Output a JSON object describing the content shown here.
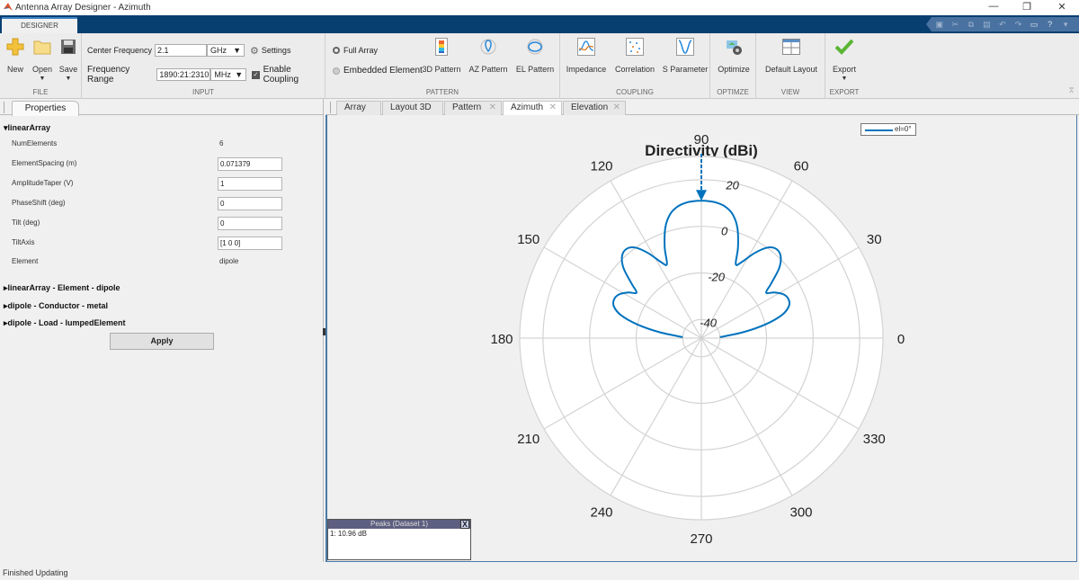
{
  "window": {
    "title": "Antenna Array Designer - Azimuth",
    "controls": [
      "—",
      "❐",
      "✕"
    ]
  },
  "tabstrip": {
    "designer_tab": "DESIGNER"
  },
  "quick_access": [
    "save-icon",
    "cut-icon",
    "copy-icon",
    "paste-icon",
    "undo-icon",
    "redo-icon",
    "layout-icon",
    "help-icon",
    "options-icon"
  ],
  "ribbon": {
    "file": {
      "label": "FILE",
      "new": "New",
      "open": "Open",
      "save": "Save"
    },
    "input": {
      "label": "INPUT",
      "center_frequency_label": "Center Frequency",
      "center_frequency_value": "2.1",
      "center_frequency_unit": "GHz",
      "frequency_range_label": "Frequency Range",
      "frequency_range_value": "1890:21:2310",
      "frequency_range_unit": "MHz",
      "settings": "Settings",
      "enable_coupling": "Enable Coupling",
      "enable_coupling_checked": true
    },
    "pattern": {
      "label": "PATTERN",
      "full_array": "Full Array",
      "embedded_element": "Embedded Element",
      "selected": "Full Array",
      "pattern_3d": "3D Pattern",
      "az_pattern": "AZ Pattern",
      "el_pattern": "EL Pattern"
    },
    "coupling": {
      "label": "COUPLING",
      "impedance": "Impedance",
      "correlation": "Correlation",
      "s_parameter": "S Parameter"
    },
    "optimize": {
      "label": "OPTIMZE",
      "optimize": "Optimize"
    },
    "view": {
      "label": "VIEW",
      "default_layout": "Default Layout"
    },
    "export": {
      "label": "EXPORT",
      "export": "Export"
    }
  },
  "properties_panel": {
    "tab": "Properties",
    "section_title": "linearArray",
    "properties": [
      {
        "label": "NumElements",
        "value": "6",
        "editable": false
      },
      {
        "label": "ElementSpacing (m)",
        "value": "0.071379",
        "editable": true
      },
      {
        "label": "AmplitudeTaper (V)",
        "value": "1",
        "editable": true
      },
      {
        "label": "PhaseShift (deg)",
        "value": "0",
        "editable": true
      },
      {
        "label": "Tilt (deg)",
        "value": "0",
        "editable": true
      },
      {
        "label": "TiltAxis",
        "value": "[1 0 0]",
        "editable": true
      },
      {
        "label": "Element",
        "value": "dipole",
        "editable": false
      }
    ],
    "collapsed_sections": [
      "linearArray - Element - dipole",
      "dipole - Conductor - metal",
      "dipole - Load - lumpedElement"
    ],
    "apply": "Apply"
  },
  "document_tabs": [
    {
      "label": "Array",
      "closable": false,
      "active": false
    },
    {
      "label": "Layout 3D",
      "closable": false,
      "active": false
    },
    {
      "label": "Pattern",
      "closable": true,
      "active": false
    },
    {
      "label": "Azimuth",
      "closable": true,
      "active": true
    },
    {
      "label": "Elevation",
      "closable": true,
      "active": false
    }
  ],
  "peaks_panel": {
    "title": "Peaks (Dataset 1)",
    "close": "X",
    "entries": [
      "1: 10.96 dB"
    ]
  },
  "status_bar": "Finished Updating",
  "colors": {
    "trace": "#0072bd",
    "grid": "#d3d3d3",
    "ribbon_blue": "#073f71"
  },
  "chart_data": {
    "type": "polar",
    "title": "Directivity (dBi)",
    "angle_ticks": [
      0,
      30,
      60,
      90,
      120,
      150,
      180,
      210,
      240,
      270,
      300,
      330
    ],
    "radial_ticks": [
      -40,
      -20,
      0,
      20
    ],
    "rlim": [
      -48,
      30
    ],
    "legend": {
      "entries": [
        "el=0°"
      ],
      "placement": "top-right"
    },
    "peak_marker": {
      "angle_deg": 90,
      "value_db": 10.96
    },
    "series": [
      {
        "name": "el=0°",
        "angles_deg": [
          3,
          8,
          12,
          16,
          20,
          24,
          28,
          32,
          35,
          38,
          42,
          46,
          50,
          54,
          58,
          62,
          65,
          68,
          72,
          76,
          80,
          84,
          88,
          90,
          92,
          96,
          100,
          104,
          108,
          112,
          115,
          118,
          122,
          126,
          130,
          134,
          138,
          142,
          145,
          148,
          152,
          156,
          160,
          164,
          168,
          172,
          177
        ],
        "values_db": [
          -40,
          -30,
          -20,
          -12,
          -8,
          -7,
          -8,
          -11,
          -14,
          -10,
          -3,
          1,
          2,
          0,
          -5,
          -11,
          -13,
          -6,
          2,
          7,
          9.5,
          10.6,
          10.96,
          10.96,
          10.96,
          10.6,
          9.5,
          7,
          2,
          -6,
          -13,
          -11,
          -5,
          0,
          2,
          1,
          -3,
          -10,
          -14,
          -11,
          -8,
          -7,
          -8,
          -12,
          -20,
          -30,
          -40
        ]
      }
    ]
  }
}
